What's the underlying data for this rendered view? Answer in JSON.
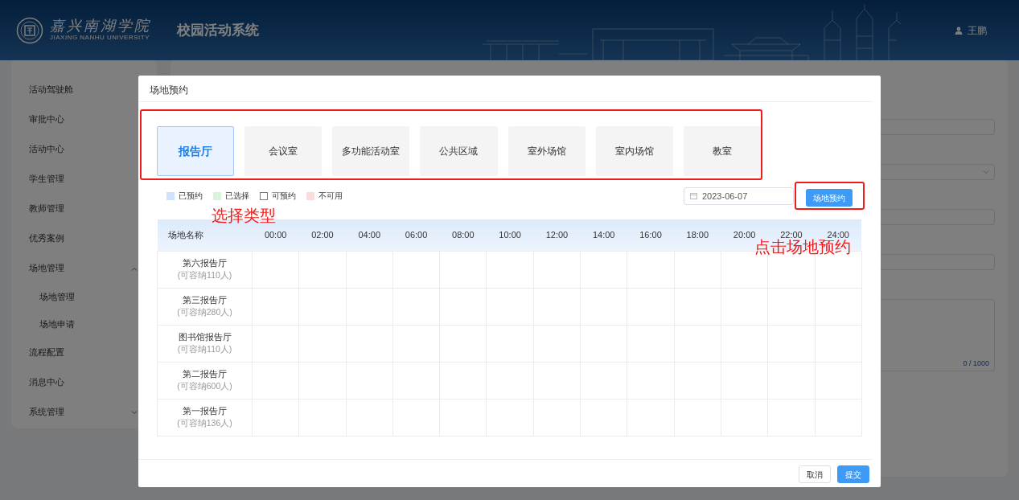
{
  "header": {
    "logo_text": "嘉兴南湖学院",
    "logo_subtitle": "JIAXING NANHU UNIVERSITY",
    "app_title": "校园活动系统",
    "user": "王鹏"
  },
  "sidebar": {
    "items": [
      {
        "label": "活动驾驶舱"
      },
      {
        "label": "审批中心"
      },
      {
        "label": "活动中心"
      },
      {
        "label": "学生管理"
      },
      {
        "label": "教师管理"
      },
      {
        "label": "优秀案例"
      },
      {
        "label": "场地管理",
        "expanded": true,
        "children": [
          {
            "label": "场地管理"
          },
          {
            "label": "场地申请"
          }
        ]
      },
      {
        "label": "流程配置"
      },
      {
        "label": "消息中心"
      },
      {
        "label": "系统管理",
        "expanded": false
      }
    ]
  },
  "background_form": {
    "fields": [
      {
        "kind": "input"
      },
      {
        "kind": "select"
      },
      {
        "kind": "input"
      },
      {
        "kind": "input"
      },
      {
        "kind": "textarea",
        "counter": "0 / 1000"
      }
    ]
  },
  "modal": {
    "title": "场地预约",
    "venue_types": [
      {
        "label": "报告厅",
        "selected": true
      },
      {
        "label": "会议室",
        "selected": false
      },
      {
        "label": "多功能活动室",
        "selected": false
      },
      {
        "label": "公共区域",
        "selected": false
      },
      {
        "label": "室外场馆",
        "selected": false
      },
      {
        "label": "室内场馆",
        "selected": false
      },
      {
        "label": "教室",
        "selected": false
      }
    ],
    "legend": [
      {
        "label": "已预约",
        "color": "#cfe3fb"
      },
      {
        "label": "已选择",
        "color": "#d7f5dd"
      },
      {
        "label": "可预约",
        "color": "#ffffff"
      },
      {
        "label": "不可用",
        "color": "#fbdcdc"
      }
    ],
    "date": "2023-06-07",
    "book_button": "场地预约",
    "table": {
      "columns": [
        "场地名称",
        "00:00",
        "02:00",
        "04:00",
        "06:00",
        "08:00",
        "10:00",
        "12:00",
        "14:00",
        "16:00",
        "18:00",
        "20:00",
        "22:00",
        "24:00"
      ],
      "rows": [
        {
          "name": "第六报告厅",
          "capacity": "(可容纳110人)"
        },
        {
          "name": "第三报告厅",
          "capacity": "(可容纳280人)"
        },
        {
          "name": "图书馆报告厅",
          "capacity": "(可容纳110人)"
        },
        {
          "name": "第二报告厅",
          "capacity": "(可容纳600人)"
        },
        {
          "name": "第一报告厅",
          "capacity": "(可容纳136人)"
        }
      ]
    },
    "buttons": [
      {
        "label": "取消",
        "kind": "default"
      },
      {
        "label": "提交",
        "kind": "primary"
      }
    ]
  },
  "annotations": [
    {
      "text": "选择类型"
    },
    {
      "text": "点击场地预约"
    }
  ]
}
